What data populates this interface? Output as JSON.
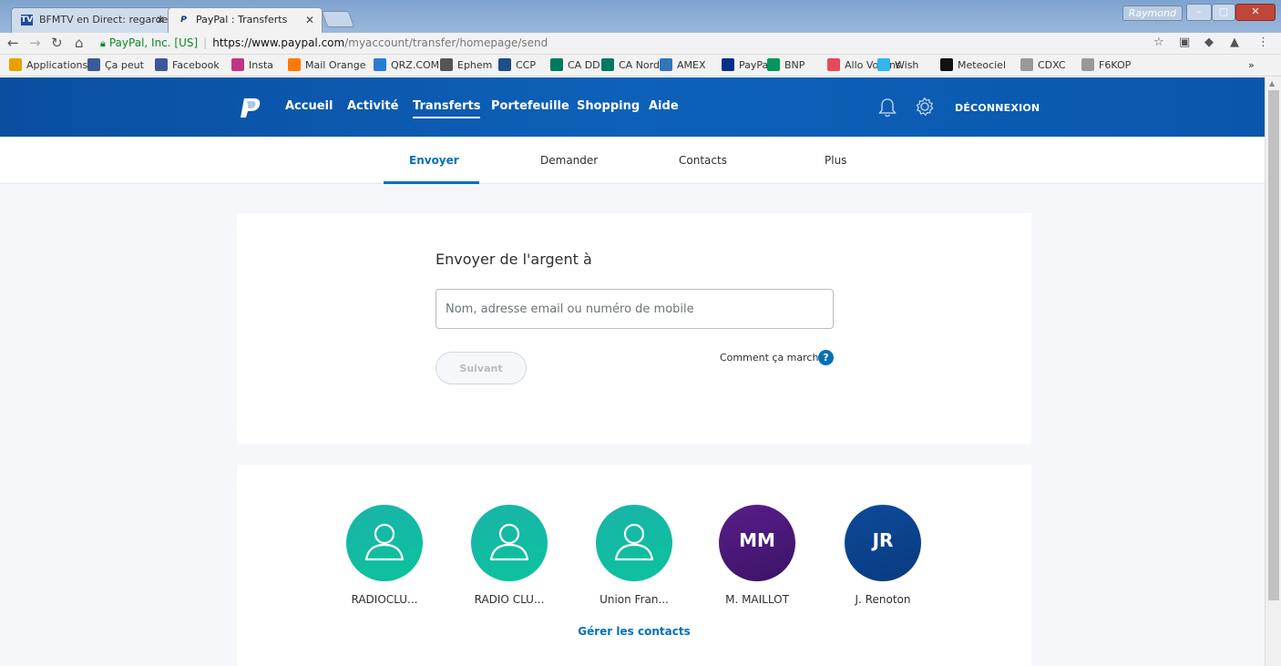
{
  "browser": {
    "tabs": [
      {
        "title": "BFMTV en Direct: regarde",
        "favicon": "TV"
      },
      {
        "title": "PayPal : Transferts",
        "favicon": "P"
      }
    ],
    "profile_name": "Raymond",
    "secure_label": "PayPal, Inc. [US]",
    "url_host": "https://www.paypal.com",
    "url_path": "/myaccount/transfer/homepage/send",
    "bookmarks": [
      {
        "label": "Applications",
        "color": "#e8a200"
      },
      {
        "label": "Ça peut",
        "color": "#3b5998"
      },
      {
        "label": "Facebook",
        "color": "#3b5998"
      },
      {
        "label": "Insta",
        "color": "#c13584"
      },
      {
        "label": "Mail Orange",
        "color": "#ff7900"
      },
      {
        "label": "QRZ.COM",
        "color": "#2a7bd5"
      },
      {
        "label": "Ephem",
        "color": "#555555"
      },
      {
        "label": "CCP",
        "color": "#1d4e89"
      },
      {
        "label": "CA DD",
        "color": "#007a5e"
      },
      {
        "label": "CA Nord",
        "color": "#007a5e"
      },
      {
        "label": "AMEX",
        "color": "#2e77bb"
      },
      {
        "label": "PayPal",
        "color": "#003087"
      },
      {
        "label": "BNP",
        "color": "#00965e"
      },
      {
        "label": "Allo Voisins",
        "color": "#e64a5a"
      },
      {
        "label": "Wish",
        "color": "#2fb7ec"
      },
      {
        "label": "Meteociel",
        "color": "#111111"
      },
      {
        "label": "CDXC",
        "color": "#999999"
      },
      {
        "label": "F6KOP",
        "color": "#999999"
      }
    ],
    "bookmarks_overflow": "»"
  },
  "paypal_header": {
    "nav": [
      "Accueil",
      "Activité",
      "Transferts",
      "Portefeuille",
      "Shopping",
      "Aide"
    ],
    "active_nav": "Transferts",
    "logout": "DÉCONNEXION"
  },
  "subnav": {
    "tabs": [
      "Envoyer",
      "Demander",
      "Contacts",
      "Plus"
    ],
    "active": "Envoyer"
  },
  "send_form": {
    "title": "Envoyer de l'argent à",
    "recipient_placeholder": "Nom, adresse email ou numéro de mobile",
    "recipient_value": "",
    "next_button": "Suivant",
    "how_it_works": "Comment ça marche",
    "help_symbol": "?"
  },
  "contacts": {
    "items": [
      {
        "name": "RADIOCLU...",
        "initials": "",
        "style": "teal"
      },
      {
        "name": "RADIO CLU...",
        "initials": "",
        "style": "teal"
      },
      {
        "name": "Union Fran...",
        "initials": "",
        "style": "teal"
      },
      {
        "name": "M. MAILLOT",
        "initials": "MM",
        "style": "purple"
      },
      {
        "name": "J. Renoton",
        "initials": "JR",
        "style": "blue"
      }
    ],
    "manage_link": "Gérer les contacts"
  },
  "colors": {
    "paypal_blue": "#0070ba",
    "header_blue": "#0d61b9",
    "teal": "#14b8a2"
  }
}
